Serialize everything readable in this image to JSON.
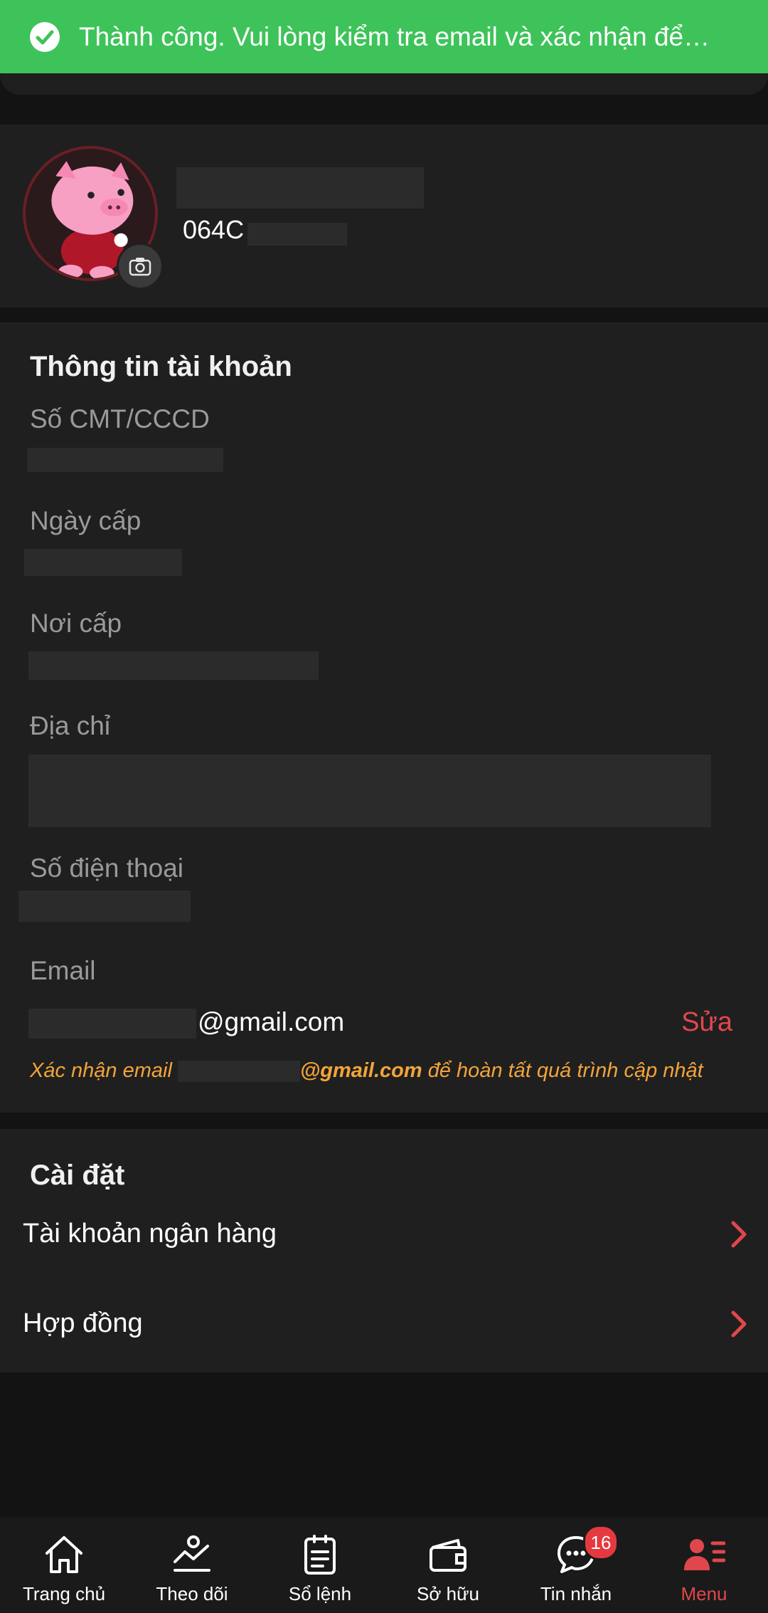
{
  "toast": {
    "message": "Thành công. Vui lòng kiểm tra email và xác nhận để…",
    "icon": "check-circle-icon",
    "color": "#3ec35a"
  },
  "profile": {
    "account_id": "064C",
    "avatar": "pig-mascot-avatar",
    "camera_icon": "camera-icon"
  },
  "account_info": {
    "title": "Thông tin tài khoản",
    "fields": {
      "id_number": "Số CMT/CCCD",
      "issue_date": "Ngày cấp",
      "issue_place": "Nơi cấp",
      "address": "Địa chỉ",
      "phone": "Số điện thoại",
      "email": "Email"
    },
    "email_value": "@gmail.com",
    "edit_label": "Sửa",
    "confirm_note_prefix": "Xác nhận email ",
    "confirm_note_email": "@gmail.com",
    "confirm_note_suffix": " để hoàn tất quá trình cập nhật"
  },
  "settings": {
    "title": "Cài đặt",
    "items": [
      {
        "label": "Tài khoản ngân hàng"
      },
      {
        "label": "Hợp đồng"
      }
    ]
  },
  "bottom_nav": {
    "items": [
      {
        "label": "Trang chủ",
        "icon": "home-icon"
      },
      {
        "label": "Theo dõi",
        "icon": "chart-icon"
      },
      {
        "label": "Sổ lệnh",
        "icon": "clipboard-icon"
      },
      {
        "label": "Sở hữu",
        "icon": "wallet-icon"
      },
      {
        "label": "Tin nhắn",
        "icon": "chat-icon",
        "badge": "16"
      },
      {
        "label": "Menu",
        "icon": "user-menu-icon",
        "active": true
      }
    ]
  },
  "colors": {
    "accent": "#e0474c",
    "note": "#f2a43a",
    "background": "#131313",
    "card": "#1f1f1f"
  }
}
